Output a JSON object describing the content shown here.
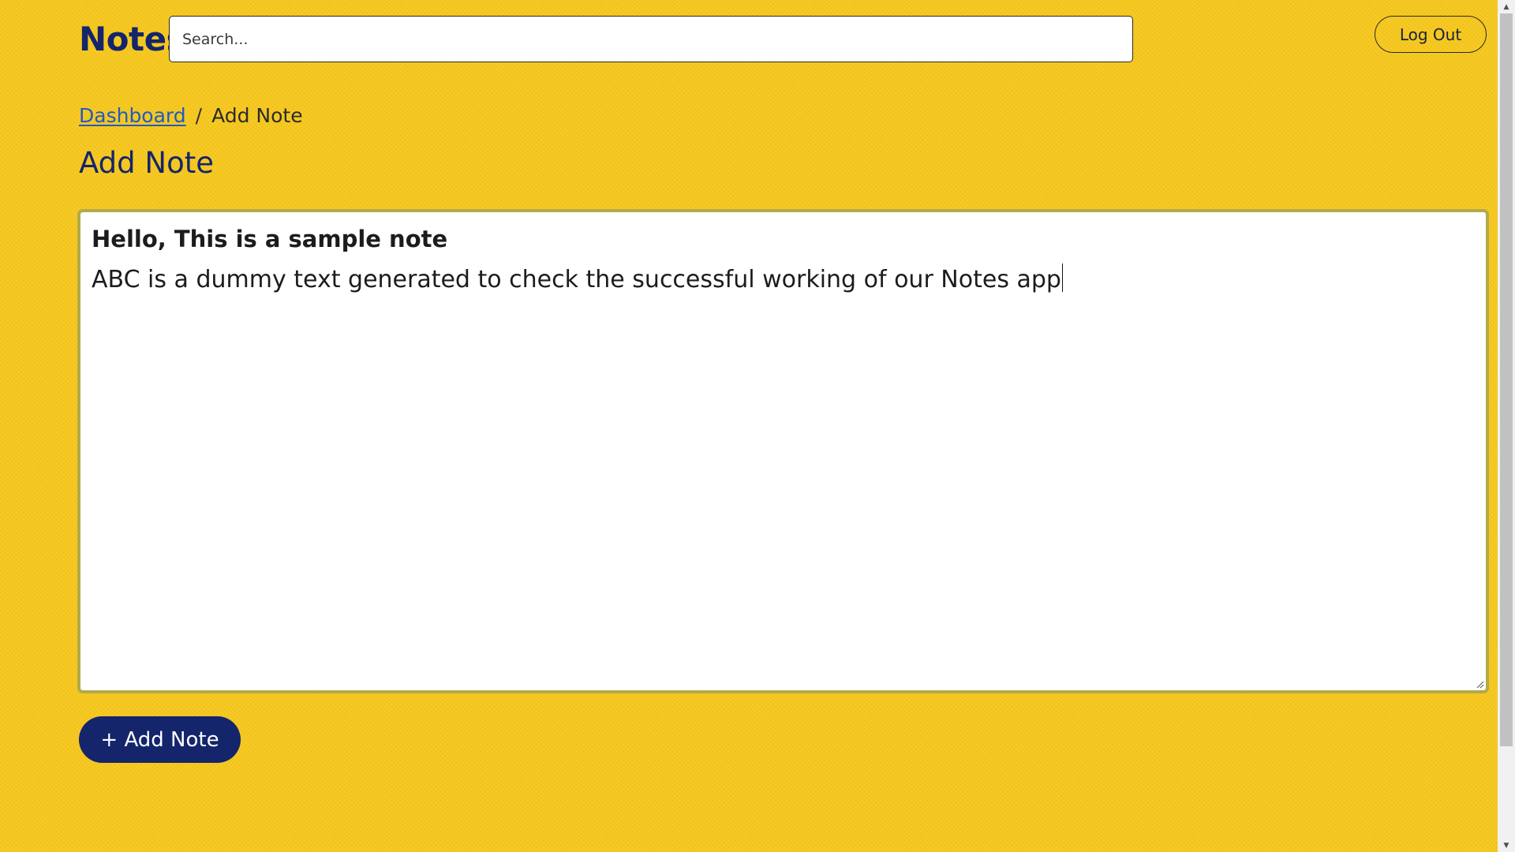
{
  "header": {
    "brand": "Notes",
    "search_placeholder": "Search...",
    "logout_label": "Log Out"
  },
  "breadcrumb": {
    "items": [
      {
        "label": "Dashboard"
      },
      {
        "label": "Add Note"
      }
    ],
    "separator": "/"
  },
  "page": {
    "title": "Add Note"
  },
  "editor": {
    "note_title": "Hello, This is a sample note",
    "note_body": "ABC is a dummy text generated to check the successful working of our Notes app"
  },
  "actions": {
    "add_note_label": "+ Add Note"
  },
  "colors": {
    "background": "#f9c91e",
    "brand": "#14256b",
    "link": "#1f5bc4",
    "button_bg": "#14256b"
  },
  "icons": {
    "scroll_up": "chevron-up-icon",
    "scroll_down": "chevron-down-icon",
    "resize": "resize-grip-icon"
  }
}
